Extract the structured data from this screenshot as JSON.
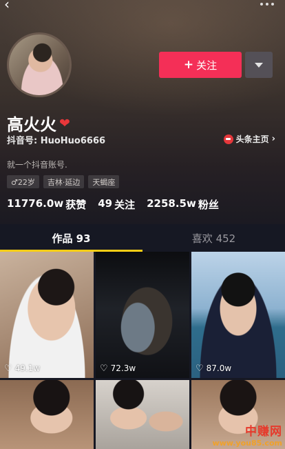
{
  "profile": {
    "name": "高火火",
    "heart_icon": "heart-icon",
    "douyin_id": "抖音号: HuoHuo6666",
    "toutiao_link": "头条主页",
    "bio": "就一个抖音账号.",
    "tags": [
      "♂22岁",
      "吉林·延边",
      "天蝎座"
    ]
  },
  "actions": {
    "follow_label": "关注",
    "follow_color": "#f42f57"
  },
  "stats": [
    {
      "value": "11776.0w",
      "label": "获赞"
    },
    {
      "value": "49",
      "label": "关注"
    },
    {
      "value": "2258.5w",
      "label": "粉丝"
    }
  ],
  "tabs": [
    {
      "label": "作品 93",
      "active": true
    },
    {
      "label": "喜欢 452",
      "active": false
    }
  ],
  "videos": [
    {
      "likes": "49.1w"
    },
    {
      "likes": "72.3w"
    },
    {
      "likes": "87.0w"
    },
    {
      "likes": ""
    },
    {
      "likes": ""
    },
    {
      "likes": ""
    }
  ],
  "watermark": {
    "line1": "中赚网",
    "line2": "www.you85.com"
  },
  "colors": {
    "accent": "#f42f57",
    "tab_indicator": "#face15",
    "background": "#161823"
  }
}
